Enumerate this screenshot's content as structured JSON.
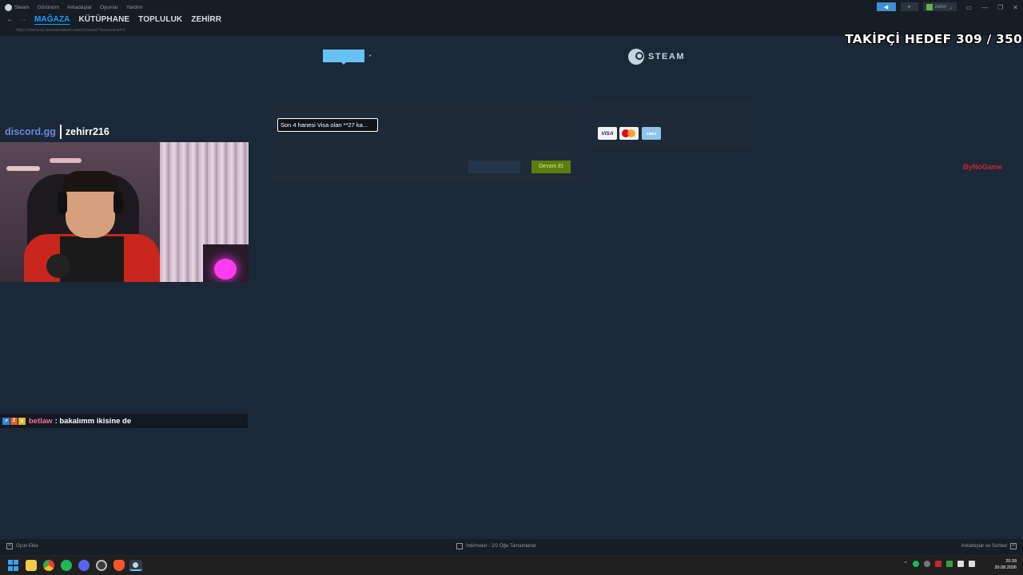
{
  "titlebar": {
    "menu": [
      "Steam",
      "Görünüm",
      "Arkadaşlar",
      "Oyunlar",
      "Yardım"
    ],
    "username": "zehirr"
  },
  "navbar": {
    "tabs": [
      "MAĞAZA",
      "KÜTÜPHANE",
      "TOPLULUK",
      "ZEHİRR"
    ],
    "active_tab": "MAĞAZA"
  },
  "url": "https://checkout.steampowered.com/checkout/?accountcart=1",
  "checkout": {
    "brand": "STEAM",
    "card_select_value": "Son 4 hanesi Visa olan **27 ka...",
    "continue_label": "Devam Et",
    "card_logos": [
      "VISA",
      "mastercard",
      "AMEX"
    ]
  },
  "overlay": {
    "follower_goal": "TAKİPÇİ HEDEF 309 / 350",
    "sponsor": "ByNoGame",
    "discord": "discord.gg",
    "handle": "zehirr216"
  },
  "chat": {
    "user": "betlaw",
    "message": ": bakalımm ikisine de"
  },
  "footer": {
    "add_game": "Oyun Ekle",
    "downloads": "İndirmeler - 2/2 Öğe Tamamlandı",
    "friends": "Arkadaşlar ve Sohbet"
  },
  "taskbar": {
    "time": "20:39",
    "date": "20.08.2026"
  }
}
